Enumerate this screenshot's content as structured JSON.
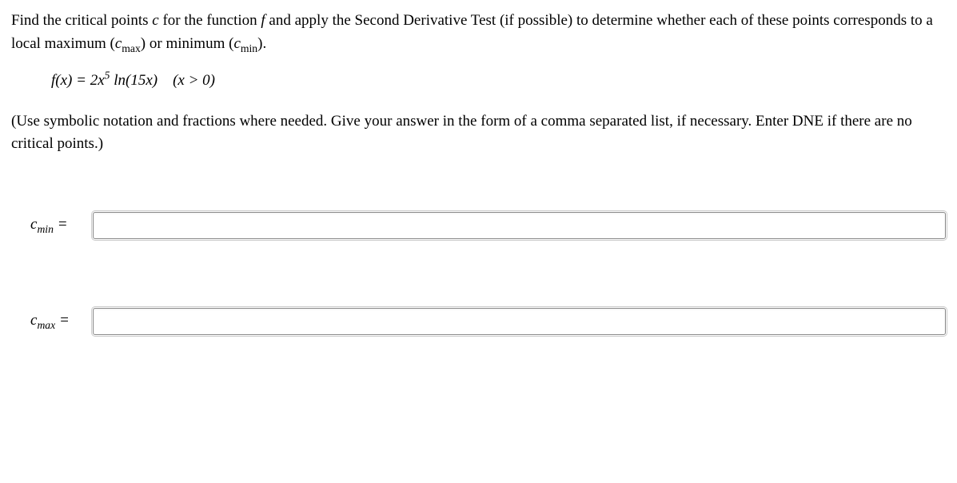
{
  "problem": {
    "line1_a": "Find the critical points ",
    "var_c": "c",
    "line1_b": " for the function ",
    "var_f": "f",
    "line1_c": " and apply the Second Derivative Test (if possible) to determine whether each of these points corresponds to a local maximum (",
    "cmax_var": "c",
    "cmax_sub": "max",
    "line1_d": ") or minimum (",
    "cmin_var": "c",
    "cmin_sub": "min",
    "line1_e": ")."
  },
  "formula": {
    "fx": "f",
    "open": "(x) = 2x",
    "exp": "5",
    "mid": " ln(15x) (x > 0)"
  },
  "instruction": "(Use symbolic notation and fractions where needed. Give your answer in the form of a comma separated list, if necessary. Enter DNE if there are no critical points.)",
  "answers": {
    "cmin": {
      "var": "c",
      "sub": "min",
      "eq": " =",
      "value": ""
    },
    "cmax": {
      "var": "c",
      "sub": "max",
      "eq": " =",
      "value": ""
    }
  }
}
